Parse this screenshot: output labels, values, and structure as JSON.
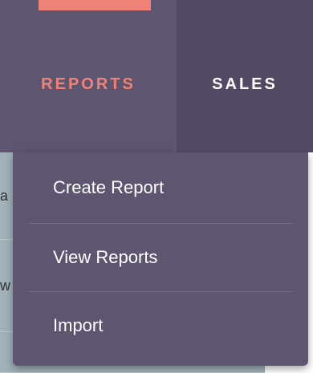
{
  "nav": {
    "tabs": [
      {
        "label": "REPORTS",
        "active": true
      },
      {
        "label": "SALES",
        "active": false
      }
    ]
  },
  "dropdown": {
    "items": [
      {
        "label": "Create Report"
      },
      {
        "label": "View Reports"
      },
      {
        "label": "Import"
      }
    ]
  },
  "background_fragments": [
    "a",
    "w"
  ],
  "colors": {
    "nav_active_bg": "#5e5570",
    "nav_inactive_bg": "#524a62",
    "accent": "#f08377",
    "dropdown_bg": "#5e5570",
    "text": "#ffffff"
  }
}
